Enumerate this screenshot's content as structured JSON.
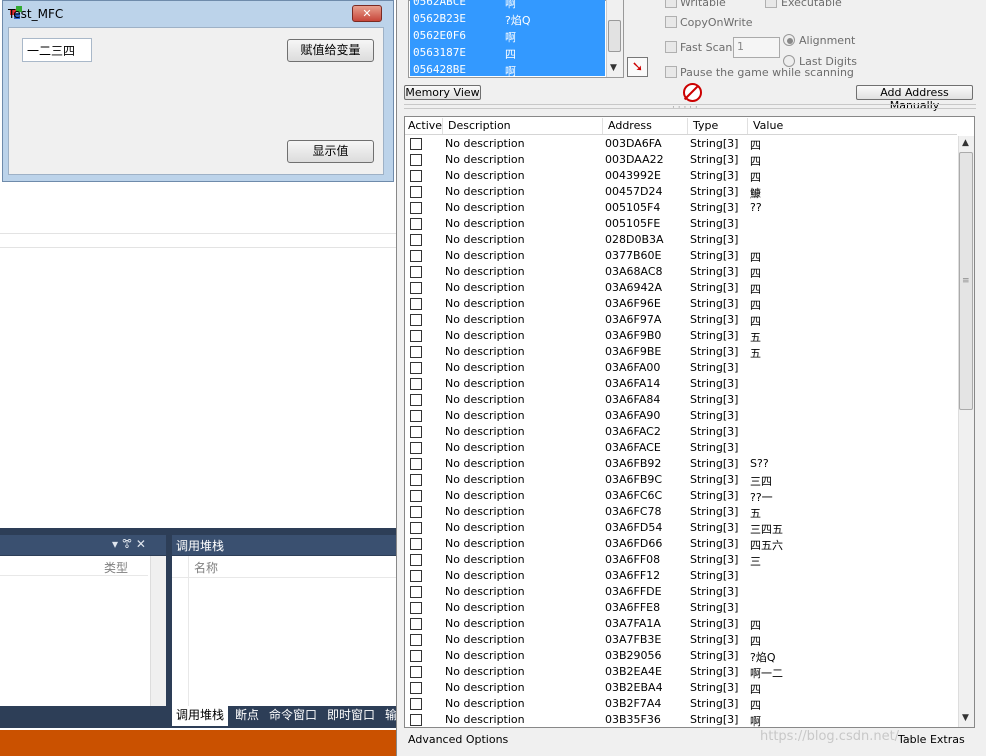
{
  "mfc": {
    "title": "Test_MFC",
    "close_glyph": "✕",
    "edit_value": "一二三四",
    "assign_button": "赋值给变量",
    "show_button": "显示值"
  },
  "vs": {
    "left_panel_controls": "▾ ꔅ ✕",
    "type_column": "类型",
    "call_stack_title": "调用堆栈",
    "name_column": "名称",
    "tabs": [
      "调用堆栈",
      "断点",
      "命令窗口",
      "即时窗口",
      "输"
    ]
  },
  "ce": {
    "found_list": [
      {
        "address": "0562ABCE",
        "value": "啊"
      },
      {
        "address": "0562B23E",
        "value": "?焰Q"
      },
      {
        "address": "0562E0F6",
        "value": "啊"
      },
      {
        "address": "0563187E",
        "value": "四"
      },
      {
        "address": "056428BE",
        "value": "啊"
      }
    ],
    "options": {
      "writable": "Writable",
      "executable": "Executable",
      "copy_on_write": "CopyOnWrite",
      "fast_scan": "Fast Scan",
      "fast_scan_value": "1",
      "alignment": "Alignment",
      "last_digits": "Last Digits",
      "pause_game": "Pause the game while scanning"
    },
    "memory_view_button": "Memory View",
    "add_address_button": "Add Address Manually",
    "columns": {
      "active": "Active",
      "description": "Description",
      "address": "Address",
      "type": "Type",
      "value": "Value"
    },
    "rows": [
      {
        "description": "No description",
        "address": "003DA6FA",
        "type": "String[3]",
        "value": "四"
      },
      {
        "description": "No description",
        "address": "003DAA22",
        "type": "String[3]",
        "value": "四"
      },
      {
        "description": "No description",
        "address": "0043992E",
        "type": "String[3]",
        "value": "四"
      },
      {
        "description": "No description",
        "address": "00457D24",
        "type": "String[3]",
        "value": "鱇"
      },
      {
        "description": "No description",
        "address": "005105F4",
        "type": "String[3]",
        "value": "??"
      },
      {
        "description": "No description",
        "address": "005105FE",
        "type": "String[3]",
        "value": ""
      },
      {
        "description": "No description",
        "address": "028D0B3A",
        "type": "String[3]",
        "value": ""
      },
      {
        "description": "No description",
        "address": "0377B60E",
        "type": "String[3]",
        "value": "四"
      },
      {
        "description": "No description",
        "address": "03A68AC8",
        "type": "String[3]",
        "value": "四"
      },
      {
        "description": "No description",
        "address": "03A6942A",
        "type": "String[3]",
        "value": "四"
      },
      {
        "description": "No description",
        "address": "03A6F96E",
        "type": "String[3]",
        "value": "四"
      },
      {
        "description": "No description",
        "address": "03A6F97A",
        "type": "String[3]",
        "value": "四"
      },
      {
        "description": "No description",
        "address": "03A6F9B0",
        "type": "String[3]",
        "value": "五"
      },
      {
        "description": "No description",
        "address": "03A6F9BE",
        "type": "String[3]",
        "value": "五"
      },
      {
        "description": "No description",
        "address": "03A6FA00",
        "type": "String[3]",
        "value": ""
      },
      {
        "description": "No description",
        "address": "03A6FA14",
        "type": "String[3]",
        "value": ""
      },
      {
        "description": "No description",
        "address": "03A6FA84",
        "type": "String[3]",
        "value": ""
      },
      {
        "description": "No description",
        "address": "03A6FA90",
        "type": "String[3]",
        "value": ""
      },
      {
        "description": "No description",
        "address": "03A6FAC2",
        "type": "String[3]",
        "value": ""
      },
      {
        "description": "No description",
        "address": "03A6FACE",
        "type": "String[3]",
        "value": ""
      },
      {
        "description": "No description",
        "address": "03A6FB92",
        "type": "String[3]",
        "value": "S??"
      },
      {
        "description": "No description",
        "address": "03A6FB9C",
        "type": "String[3]",
        "value": "三四"
      },
      {
        "description": "No description",
        "address": "03A6FC6C",
        "type": "String[3]",
        "value": "??一"
      },
      {
        "description": "No description",
        "address": "03A6FC78",
        "type": "String[3]",
        "value": "五"
      },
      {
        "description": "No description",
        "address": "03A6FD54",
        "type": "String[3]",
        "value": "三四五"
      },
      {
        "description": "No description",
        "address": "03A6FD66",
        "type": "String[3]",
        "value": "四五六"
      },
      {
        "description": "No description",
        "address": "03A6FF08",
        "type": "String[3]",
        "value": "三"
      },
      {
        "description": "No description",
        "address": "03A6FF12",
        "type": "String[3]",
        "value": ""
      },
      {
        "description": "No description",
        "address": "03A6FFDE",
        "type": "String[3]",
        "value": ""
      },
      {
        "description": "No description",
        "address": "03A6FFE8",
        "type": "String[3]",
        "value": ""
      },
      {
        "description": "No description",
        "address": "03A7FA1A",
        "type": "String[3]",
        "value": "四"
      },
      {
        "description": "No description",
        "address": "03A7FB3E",
        "type": "String[3]",
        "value": "四"
      },
      {
        "description": "No description",
        "address": "03B29056",
        "type": "String[3]",
        "value": "?焰Q"
      },
      {
        "description": "No description",
        "address": "03B2EA4E",
        "type": "String[3]",
        "value": "啊一二"
      },
      {
        "description": "No description",
        "address": "03B2EBA4",
        "type": "String[3]",
        "value": "四"
      },
      {
        "description": "No description",
        "address": "03B2F7A4",
        "type": "String[3]",
        "value": "四"
      },
      {
        "description": "No description",
        "address": "03B35F36",
        "type": "String[3]",
        "value": "啊"
      }
    ],
    "advanced_options": "Advanced Options",
    "table_extras": "Table Extras",
    "watermark": "https://blog.csdn.net/..."
  }
}
